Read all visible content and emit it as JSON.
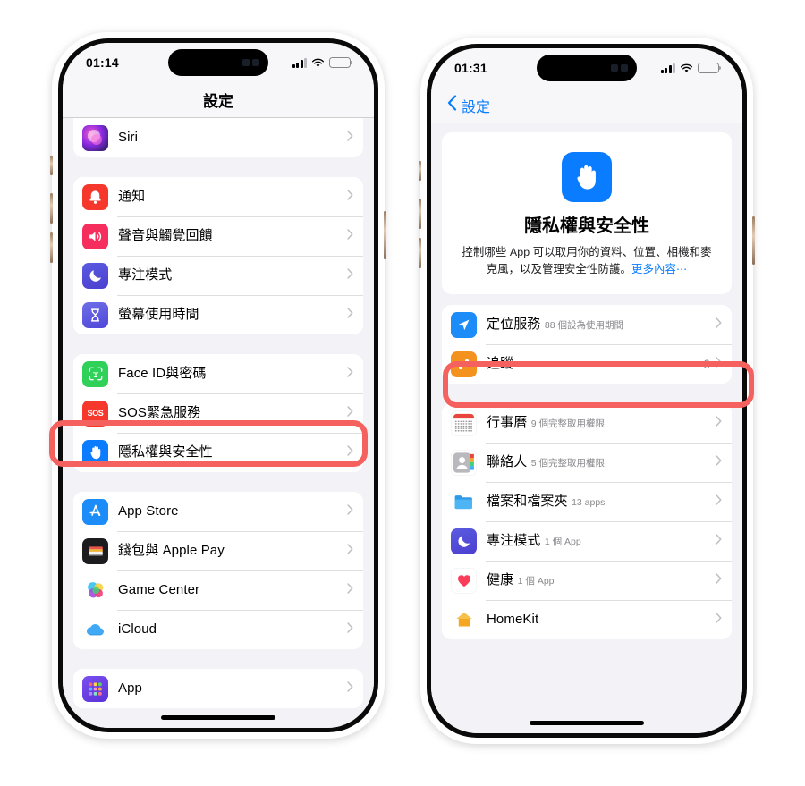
{
  "colors": {
    "accent_blue": "#0a7cff",
    "highlight_red": "#f4615f",
    "page_bg": "#f2f2f7",
    "card_bg": "#ffffff"
  },
  "left_phone": {
    "status": {
      "time": "01:14",
      "signal": "cellular-bars-icon",
      "wifi": "wifi-icon",
      "battery": "battery-low-icon"
    },
    "navbar": {
      "title": "設定"
    },
    "groups": [
      {
        "id": "siri-group",
        "rows": [
          {
            "label": "Siri",
            "icon": "siri-icon",
            "icon_kind": "siri"
          }
        ]
      },
      {
        "id": "system-group",
        "rows": [
          {
            "label": "通知",
            "icon": "notifications-icon",
            "icon_kind": "bell"
          },
          {
            "label": "聲音與觸覺回饋",
            "icon": "sounds-haptics-icon",
            "icon_kind": "speaker"
          },
          {
            "label": "專注模式",
            "icon": "focus-icon",
            "icon_kind": "moon"
          },
          {
            "label": "螢幕使用時間",
            "icon": "screen-time-icon",
            "icon_kind": "hourglass"
          }
        ]
      },
      {
        "id": "security-group",
        "rows": [
          {
            "label": "Face ID與密碼",
            "icon": "face-id-icon",
            "icon_kind": "faceid"
          },
          {
            "label": "SOS緊急服務",
            "icon": "emergency-sos-icon",
            "icon_kind": "sos"
          },
          {
            "label": "隱私權與安全性",
            "icon": "privacy-security-icon",
            "icon_kind": "hand",
            "highlighted": true
          }
        ]
      },
      {
        "id": "services-group",
        "rows": [
          {
            "label": "App Store",
            "icon": "app-store-icon",
            "icon_kind": "appstore"
          },
          {
            "label": "錢包與 Apple Pay",
            "icon": "wallet-icon",
            "icon_kind": "wallet"
          },
          {
            "label": "Game Center",
            "icon": "game-center-icon",
            "icon_kind": "gamecenter"
          },
          {
            "label": "iCloud",
            "icon": "icloud-icon",
            "icon_kind": "icloud"
          }
        ]
      },
      {
        "id": "apps-group",
        "rows": [
          {
            "label": "App",
            "icon": "apps-icon",
            "icon_kind": "apps"
          }
        ]
      }
    ]
  },
  "right_phone": {
    "status": {
      "time": "01:31",
      "signal": "cellular-bars-icon",
      "wifi": "wifi-icon",
      "battery": "battery-low-icon"
    },
    "navbar": {
      "back_label": "設定"
    },
    "hero": {
      "icon": "privacy-hand-icon",
      "title": "隱私權與安全性",
      "description": "控制哪些 App 可以取用你的資料、位置、相機和麥克風，以及管理安全性防護。",
      "link": "更多內容⋯"
    },
    "groups": [
      {
        "id": "location-group",
        "rows": [
          {
            "label": "定位服務",
            "sub": "88 個設為使用期間",
            "icon": "location-services-icon",
            "icon_kind": "arrow",
            "highlighted": true
          },
          {
            "label": "追蹤",
            "value": "0",
            "icon": "tracking-icon",
            "icon_kind": "tracking"
          }
        ]
      },
      {
        "id": "permissions-group",
        "rows": [
          {
            "label": "行事曆",
            "sub": "9 個完整取用權限",
            "icon": "calendar-icon",
            "icon_kind": "calendar"
          },
          {
            "label": "聯絡人",
            "sub": "5 個完整取用權限",
            "icon": "contacts-icon",
            "icon_kind": "contacts"
          },
          {
            "label": "檔案和檔案夾",
            "sub": "13 apps",
            "icon": "files-folders-icon",
            "icon_kind": "folder"
          },
          {
            "label": "專注模式",
            "sub": "1 個 App",
            "icon": "focus-icon",
            "icon_kind": "moon"
          },
          {
            "label": "健康",
            "sub": "1 個 App",
            "icon": "health-icon",
            "icon_kind": "heart"
          },
          {
            "label": "HomeKit",
            "icon": "homekit-icon",
            "icon_kind": "home"
          }
        ]
      }
    ]
  }
}
